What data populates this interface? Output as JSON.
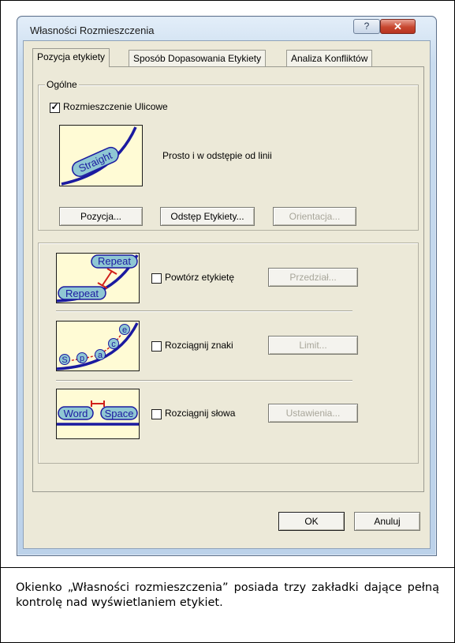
{
  "window": {
    "title": "Własności Rozmieszczenia",
    "help_glyph": "?",
    "close_glyph": "✕"
  },
  "tabs": [
    {
      "label": "Pozycja etykiety",
      "active": true
    },
    {
      "label": "Sposób Dopasowania Etykiety",
      "active": false
    },
    {
      "label": "Analiza Konfliktów",
      "active": false
    }
  ],
  "general_group": {
    "title": "Ogólne",
    "street_checkbox": {
      "label": "Rozmieszczenie Ulicowe",
      "checked": true,
      "check_glyph": "✓"
    },
    "preview_label": "Straight",
    "description": "Prosto i w odstępie od linii",
    "buttons": {
      "position": "Pozycja...",
      "offset": "Odstęp Etykiety...",
      "orientation": "Orientacja..."
    }
  },
  "options_group": {
    "repeat": {
      "preview_top": "Repeat",
      "preview_bottom": "Repeat",
      "checkbox_label": "Powtórz etykietę",
      "checked": false,
      "button": "Przedział..."
    },
    "stretch_chars": {
      "preview_letters": [
        "S",
        "p",
        "a",
        "c",
        "e"
      ],
      "checkbox_label": "Rozciągnij znaki",
      "checked": false,
      "button": "Limit..."
    },
    "stretch_words": {
      "preview_word1": "Word",
      "preview_word2": "Space",
      "checkbox_label": "Rozciągnij słowa",
      "checked": false,
      "button": "Ustawienia..."
    }
  },
  "dialog_buttons": {
    "ok": "OK",
    "cancel": "Anuluj"
  },
  "caption": "Okienko „Własności rozmieszczenia” posiada trzy zakładki dające pełną kontrolę nad wyświetlaniem etykiet.",
  "colors": {
    "line": "#1b1aa0",
    "label_fill": "#8fc7d3",
    "red": "#d0201a",
    "thumb_bg": "#fffbd5"
  }
}
